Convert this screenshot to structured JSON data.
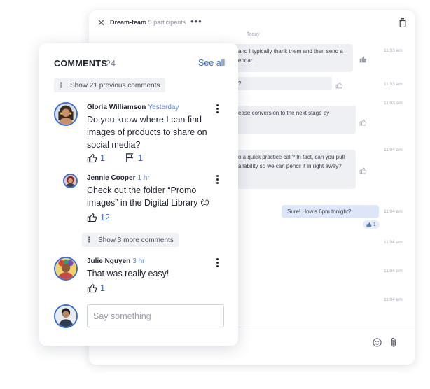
{
  "chat": {
    "title": "Dream-team",
    "subtitle": "• 5 participants",
    "more": "•••",
    "close": "✕",
    "day_label": "Today",
    "messages": [
      {
        "text_line1": "and I typically thank them and then send a",
        "text_line2": "endar.",
        "time": "11:03 am"
      },
      {
        "text_line1": "?",
        "time": "11:03 am"
      },
      {
        "text_line1": "ease conversion to the next stage by",
        "time": "11:03 am"
      },
      {
        "text_line1": "o a quick practice call? In fact, can you pull",
        "text_line2": "ailability so we can pencil it in right away?",
        "time": "11:04 am"
      },
      {
        "text_line1": "Sure! How’s 6pm tonight?",
        "time": "11:04 am",
        "reaction_count": "1"
      },
      {
        "time": "11:04 am"
      },
      {
        "time": "11:04 am"
      },
      {
        "time": "11:04 am"
      }
    ]
  },
  "comments_panel": {
    "title": "COMMENTS",
    "count": "24",
    "see_all": "See all",
    "show_previous": "Show 21 previous comments",
    "show_more": "Show 3 more comments",
    "input_placeholder": "Say something",
    "comments": [
      {
        "author": "Gloria Williamson",
        "time": "Yesterday",
        "text": "Do you know where I can find images of products to share on social media?",
        "likes": "1",
        "flags": "1"
      },
      {
        "author": "Jennie Cooper",
        "time": "1 hr",
        "text": "Check out the folder “Promo images” in the Digital Library 😊",
        "likes": "12"
      },
      {
        "author": "Julie Nguyen",
        "time": "3 hr",
        "text": "That was really easy!",
        "likes": "1"
      }
    ]
  },
  "colors": {
    "accent": "#3d6fd0",
    "avatar_ring": "#3d6fd0"
  }
}
